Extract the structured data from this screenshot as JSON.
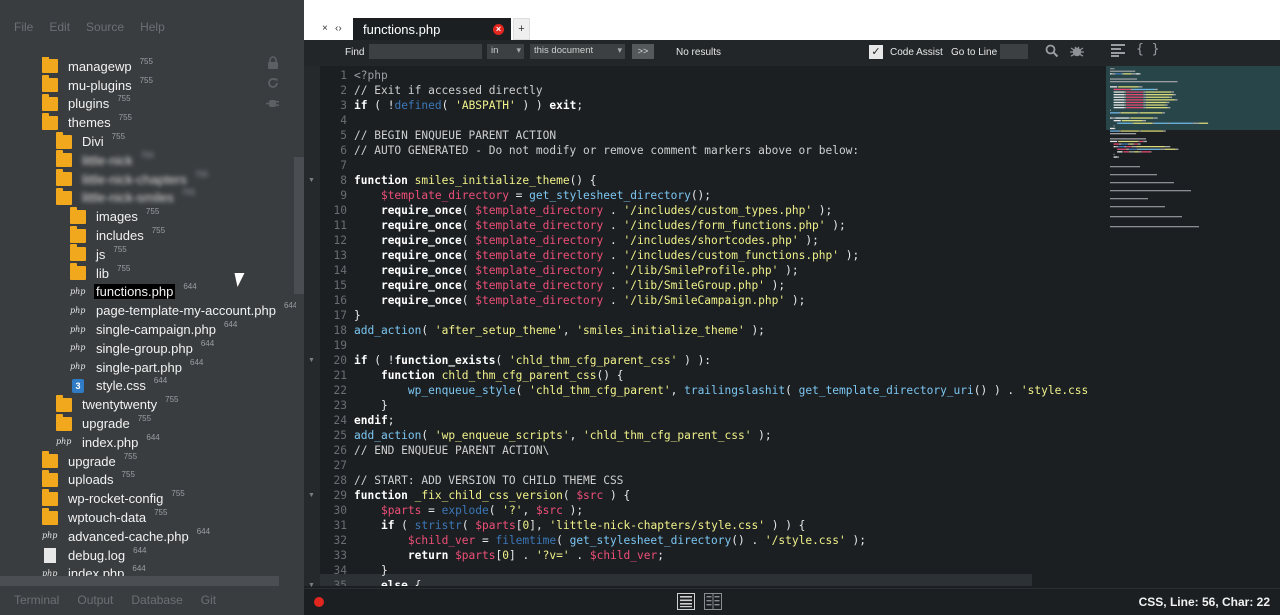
{
  "menubar": [
    "File",
    "Edit",
    "Source",
    "Help"
  ],
  "bottom_tabs": [
    "Terminal",
    "Output",
    "Database",
    "Git"
  ],
  "tree": [
    {
      "name": "managewp",
      "perm": "755",
      "type": "folder",
      "indent": 42
    },
    {
      "name": "mu-plugins",
      "perm": "755",
      "type": "folder",
      "indent": 42
    },
    {
      "name": "plugins",
      "perm": "755",
      "type": "folder",
      "indent": 42
    },
    {
      "name": "themes",
      "perm": "755",
      "type": "folder",
      "indent": 42
    },
    {
      "name": "Divi",
      "perm": "755",
      "type": "folder",
      "indent": 56
    },
    {
      "name": "little-nick",
      "perm": "755",
      "type": "folder",
      "indent": 56,
      "blur": true
    },
    {
      "name": "little-nick-chapters",
      "perm": "755",
      "type": "folder",
      "indent": 56,
      "blur": true
    },
    {
      "name": "little-nick-smiles",
      "perm": "755",
      "type": "folder",
      "indent": 56,
      "blur": true
    },
    {
      "name": "images",
      "perm": "755",
      "type": "folder",
      "indent": 70
    },
    {
      "name": "includes",
      "perm": "755",
      "type": "folder",
      "indent": 70
    },
    {
      "name": "js",
      "perm": "755",
      "type": "folder",
      "indent": 70
    },
    {
      "name": "lib",
      "perm": "755",
      "type": "folder",
      "indent": 70
    },
    {
      "name": "functions.php",
      "perm": "644",
      "type": "php",
      "indent": 70,
      "selected": true
    },
    {
      "name": "page-template-my-account.php",
      "perm": "644",
      "type": "php",
      "indent": 70
    },
    {
      "name": "single-campaign.php",
      "perm": "644",
      "type": "php",
      "indent": 70
    },
    {
      "name": "single-group.php",
      "perm": "644",
      "type": "php",
      "indent": 70
    },
    {
      "name": "single-part.php",
      "perm": "644",
      "type": "php",
      "indent": 70
    },
    {
      "name": "style.css",
      "perm": "644",
      "type": "css",
      "indent": 70
    },
    {
      "name": "twentytwenty",
      "perm": "755",
      "type": "folder",
      "indent": 56
    },
    {
      "name": "upgrade",
      "perm": "755",
      "type": "folder",
      "indent": 56
    },
    {
      "name": "index.php",
      "perm": "644",
      "type": "php",
      "indent": 56
    },
    {
      "name": "upgrade",
      "perm": "755",
      "type": "folder",
      "indent": 42
    },
    {
      "name": "uploads",
      "perm": "755",
      "type": "folder",
      "indent": 42
    },
    {
      "name": "wp-rocket-config",
      "perm": "755",
      "type": "folder",
      "indent": 42
    },
    {
      "name": "wptouch-data",
      "perm": "755",
      "type": "folder",
      "indent": 42
    },
    {
      "name": "advanced-cache.php",
      "perm": "644",
      "type": "php",
      "indent": 42
    },
    {
      "name": "debug.log",
      "perm": "644",
      "type": "doc",
      "indent": 42
    },
    {
      "name": "index.php",
      "perm": "644",
      "type": "php",
      "indent": 42
    }
  ],
  "tab": {
    "nav_close": "×",
    "nav_arrows": "‹›",
    "name": "functions.php",
    "close": "×",
    "add": "+"
  },
  "find": {
    "label": "Find",
    "in_label": "in",
    "scope": "this document",
    "next": ">>",
    "results": "No results",
    "code_assist": "Code Assist",
    "goto_label": "Go to Line",
    "check": "✓"
  },
  "icon_glyphs": {
    "php": "php",
    "css": "3",
    "braces": "{ }"
  },
  "status": {
    "text": "CSS, Line: 56, Char: 22"
  },
  "editor": {
    "lines": [
      [
        [
          "p",
          "<?php"
        ]
      ],
      [
        [
          "c",
          "// Exit if accessed directly"
        ]
      ],
      [
        [
          "k",
          "if"
        ],
        [
          "o",
          " ( "
        ],
        [
          "o",
          "!"
        ],
        [
          "b",
          "defined"
        ],
        [
          "o",
          "( "
        ],
        [
          "s",
          "'ABSPATH'"
        ],
        [
          "o",
          " ) ) "
        ],
        [
          "k",
          "exit"
        ],
        [
          "o",
          ";"
        ]
      ],
      [],
      [
        [
          "c",
          "// BEGIN ENQUEUE PARENT ACTION"
        ]
      ],
      [
        [
          "c",
          "// AUTO GENERATED - Do not modify or remove comment markers above or below:"
        ]
      ],
      [],
      [
        [
          "k",
          "function"
        ],
        [
          "o",
          " "
        ],
        [
          "s",
          "smiles_initialize_theme"
        ],
        [
          "o",
          "() {"
        ]
      ],
      [
        [
          "i",
          "    "
        ],
        [
          "v",
          "$template_directory"
        ],
        [
          "o",
          " = "
        ],
        [
          "f",
          "get_stylesheet_directory"
        ],
        [
          "o",
          "();"
        ]
      ],
      [
        [
          "i",
          "    "
        ],
        [
          "k",
          "require_once"
        ],
        [
          "o",
          "( "
        ],
        [
          "v",
          "$template_directory"
        ],
        [
          "o",
          " . "
        ],
        [
          "s",
          "'/includes/custom_types.php'"
        ],
        [
          "o",
          " );"
        ]
      ],
      [
        [
          "i",
          "    "
        ],
        [
          "k",
          "require_once"
        ],
        [
          "o",
          "( "
        ],
        [
          "v",
          "$template_directory"
        ],
        [
          "o",
          " . "
        ],
        [
          "s",
          "'/includes/form_functions.php'"
        ],
        [
          "o",
          " );"
        ]
      ],
      [
        [
          "i",
          "    "
        ],
        [
          "k",
          "require_once"
        ],
        [
          "o",
          "( "
        ],
        [
          "v",
          "$template_directory"
        ],
        [
          "o",
          " . "
        ],
        [
          "s",
          "'/includes/shortcodes.php'"
        ],
        [
          "o",
          " );"
        ]
      ],
      [
        [
          "i",
          "    "
        ],
        [
          "k",
          "require_once"
        ],
        [
          "o",
          "( "
        ],
        [
          "v",
          "$template_directory"
        ],
        [
          "o",
          " . "
        ],
        [
          "s",
          "'/includes/custom_functions.php'"
        ],
        [
          "o",
          " );"
        ]
      ],
      [
        [
          "i",
          "    "
        ],
        [
          "k",
          "require_once"
        ],
        [
          "o",
          "( "
        ],
        [
          "v",
          "$template_directory"
        ],
        [
          "o",
          " . "
        ],
        [
          "s",
          "'/lib/SmileProfile.php'"
        ],
        [
          "o",
          " );"
        ]
      ],
      [
        [
          "i",
          "    "
        ],
        [
          "k",
          "require_once"
        ],
        [
          "o",
          "( "
        ],
        [
          "v",
          "$template_directory"
        ],
        [
          "o",
          " . "
        ],
        [
          "s",
          "'/lib/SmileGroup.php'"
        ],
        [
          "o",
          " );"
        ]
      ],
      [
        [
          "i",
          "    "
        ],
        [
          "k",
          "require_once"
        ],
        [
          "o",
          "( "
        ],
        [
          "v",
          "$template_directory"
        ],
        [
          "o",
          " . "
        ],
        [
          "s",
          "'/lib/SmileCampaign.php'"
        ],
        [
          "o",
          " );"
        ]
      ],
      [
        [
          "o",
          "}"
        ]
      ],
      [
        [
          "f",
          "add_action"
        ],
        [
          "o",
          "( "
        ],
        [
          "s",
          "'after_setup_theme'"
        ],
        [
          "o",
          ", "
        ],
        [
          "s",
          "'smiles_initialize_theme'"
        ],
        [
          "o",
          " );"
        ]
      ],
      [],
      [
        [
          "k",
          "if"
        ],
        [
          "o",
          " ( !"
        ],
        [
          "k",
          "function_exists"
        ],
        [
          "o",
          "( "
        ],
        [
          "s",
          "'chld_thm_cfg_parent_css'"
        ],
        [
          "o",
          " ) ):"
        ]
      ],
      [
        [
          "i",
          "    "
        ],
        [
          "k",
          "function"
        ],
        [
          "o",
          " "
        ],
        [
          "s",
          "chld_thm_cfg_parent_css"
        ],
        [
          "o",
          "() {"
        ]
      ],
      [
        [
          "i",
          "        "
        ],
        [
          "f",
          "wp_enqueue_style"
        ],
        [
          "o",
          "( "
        ],
        [
          "s",
          "'chld_thm_cfg_parent'"
        ],
        [
          "o",
          ", "
        ],
        [
          "f",
          "trailingslashit"
        ],
        [
          "o",
          "( "
        ],
        [
          "f",
          "get_template_directory_uri"
        ],
        [
          "o",
          "() ) . "
        ],
        [
          "s",
          "'style.css"
        ]
      ],
      [
        [
          "i",
          "    "
        ],
        [
          "o",
          "}"
        ]
      ],
      [
        [
          "k",
          "endif"
        ],
        [
          "o",
          ";"
        ]
      ],
      [
        [
          "f",
          "add_action"
        ],
        [
          "o",
          "( "
        ],
        [
          "s",
          "'wp_enqueue_scripts'"
        ],
        [
          "o",
          ", "
        ],
        [
          "s",
          "'chld_thm_cfg_parent_css'"
        ],
        [
          "o",
          " );"
        ]
      ],
      [
        [
          "c",
          "// END ENQUEUE PARENT ACTION\\"
        ]
      ],
      [],
      [
        [
          "c",
          "// START: ADD VERSION TO CHILD THEME CSS"
        ]
      ],
      [
        [
          "k",
          "function"
        ],
        [
          "o",
          " "
        ],
        [
          "s",
          "_fix_child_css_version"
        ],
        [
          "o",
          "( "
        ],
        [
          "v",
          "$src"
        ],
        [
          "o",
          " ) {"
        ]
      ],
      [
        [
          "i",
          "    "
        ],
        [
          "v",
          "$parts"
        ],
        [
          "o",
          " = "
        ],
        [
          "b",
          "explode"
        ],
        [
          "o",
          "( "
        ],
        [
          "s",
          "'?'"
        ],
        [
          "o",
          ", "
        ],
        [
          "v",
          "$src"
        ],
        [
          "o",
          " );"
        ]
      ],
      [
        [
          "i",
          "    "
        ],
        [
          "k",
          "if"
        ],
        [
          "o",
          " ( "
        ],
        [
          "b",
          "stristr"
        ],
        [
          "o",
          "( "
        ],
        [
          "v",
          "$parts"
        ],
        [
          "o",
          "["
        ],
        [
          "s",
          "0"
        ],
        [
          "o",
          "], "
        ],
        [
          "s",
          "'little-nick-chapters/style.css'"
        ],
        [
          "o",
          " ) ) {"
        ]
      ],
      [
        [
          "i",
          "        "
        ],
        [
          "v",
          "$child_ver"
        ],
        [
          "o",
          " = "
        ],
        [
          "b",
          "filemtime"
        ],
        [
          "o",
          "( "
        ],
        [
          "f",
          "get_stylesheet_directory"
        ],
        [
          "o",
          "() . "
        ],
        [
          "s",
          "'/style.css'"
        ],
        [
          "o",
          " );"
        ]
      ],
      [
        [
          "i",
          "        "
        ],
        [
          "k",
          "return"
        ],
        [
          "o",
          " "
        ],
        [
          "v",
          "$parts"
        ],
        [
          "o",
          "["
        ],
        [
          "s",
          "0"
        ],
        [
          "o",
          "] . "
        ],
        [
          "s",
          "'?v='"
        ],
        [
          "o",
          " . "
        ],
        [
          "v",
          "$child_ver"
        ],
        [
          "o",
          ";"
        ]
      ],
      [
        [
          "i",
          "    "
        ],
        [
          "o",
          "}"
        ]
      ],
      [
        [
          "i",
          "    "
        ],
        [
          "k",
          "else"
        ],
        [
          "o",
          " {"
        ]
      ]
    ]
  },
  "fold_lines": [
    8,
    20,
    29,
    35
  ]
}
